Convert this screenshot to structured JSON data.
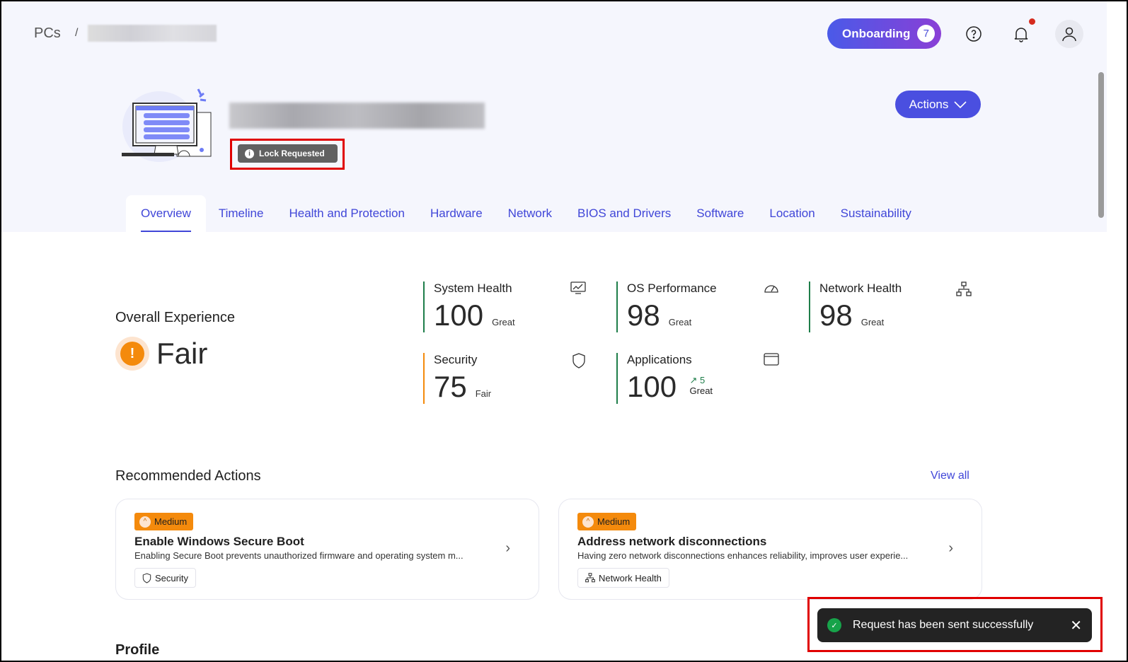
{
  "breadcrumb": {
    "root": "PCs",
    "separator": "/"
  },
  "header": {
    "onboarding_label": "Onboarding",
    "onboarding_count": "7",
    "actions_label": "Actions",
    "status_badge": "Lock Requested"
  },
  "tabs": [
    {
      "label": "Overview",
      "active": true
    },
    {
      "label": "Timeline"
    },
    {
      "label": "Health and Protection"
    },
    {
      "label": "Hardware"
    },
    {
      "label": "Network"
    },
    {
      "label": "BIOS and Drivers"
    },
    {
      "label": "Software"
    },
    {
      "label": "Location"
    },
    {
      "label": "Sustainability"
    }
  ],
  "overall": {
    "title": "Overall Experience",
    "value": "Fair",
    "color": "#f48a0c"
  },
  "metrics": [
    {
      "name": "System Health",
      "score": "100",
      "rating": "Great",
      "icon": "monitor-chart-icon",
      "color": "#1e7e4a"
    },
    {
      "name": "OS Performance",
      "score": "98",
      "rating": "Great",
      "icon": "gauge-icon",
      "color": "#1e7e4a"
    },
    {
      "name": "Network Health",
      "score": "98",
      "rating": "Great",
      "icon": "network-icon",
      "color": "#1e7e4a"
    },
    {
      "name": "Security",
      "score": "75",
      "rating": "Fair",
      "icon": "shield-icon",
      "color": "#f48a0c"
    },
    {
      "name": "Applications",
      "score": "100",
      "rating": "Great",
      "trend": "↗ 5",
      "icon": "window-icon",
      "color": "#1e7e4a"
    }
  ],
  "recommended": {
    "title": "Recommended Actions",
    "view_all": "View all",
    "items": [
      {
        "priority": "Medium",
        "title": "Enable Windows Secure Boot",
        "description": "Enabling Secure Boot prevents unauthorized firmware and operating system m...",
        "tag": "Security"
      },
      {
        "priority": "Medium",
        "title": "Address network disconnections",
        "description": "Having zero network disconnections enhances reliability, improves user experie...",
        "tag": "Network Health"
      }
    ]
  },
  "profile": {
    "title": "Profile"
  },
  "toast": {
    "message": "Request has been sent successfully"
  }
}
